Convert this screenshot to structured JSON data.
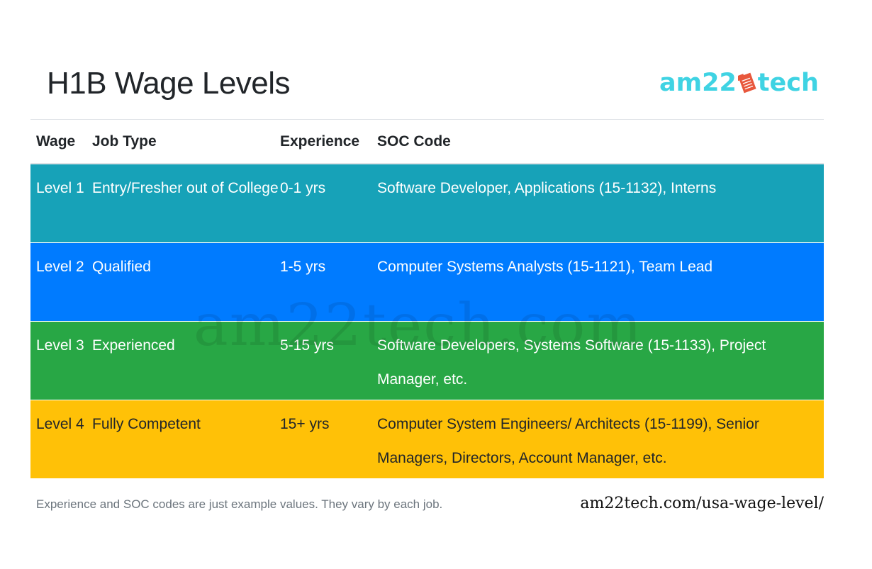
{
  "title": "H1B Wage Levels",
  "logo": {
    "text_left": "am22",
    "icon": "document-icon",
    "text_right": "tech",
    "brand_color": "#3fd3e3",
    "icon_color": "#e8573c"
  },
  "table": {
    "headers": [
      "Wage",
      "Job Type",
      "Experience",
      "SOC Code"
    ],
    "rows": [
      {
        "wage": "Level 1",
        "job_type": "Entry/Fresher out of College",
        "experience": "0-1 yrs",
        "soc_code": "Software Developer, Applications (15-1132), Interns",
        "color": "#17a2b8"
      },
      {
        "wage": "Level 2",
        "job_type": "Qualified",
        "experience": "1-5 yrs",
        "soc_code": "Computer Systems Analysts (15-1121), Team Lead",
        "color": "#007bff"
      },
      {
        "wage": "Level 3",
        "job_type": "Experienced",
        "experience": "5-15 yrs",
        "soc_code": "Software Developers, Systems Software (15-1133), Project Manager, etc.",
        "color": "#28a745"
      },
      {
        "wage": "Level 4",
        "job_type": "Fully Competent",
        "experience": "15+ yrs",
        "soc_code": "Computer System Engineers/ Architects (15-1199), Senior Managers, Directors, Account Manager, etc.",
        "color": "#ffc107"
      }
    ]
  },
  "watermark": "am22tech.com",
  "footnote": "Experience and SOC codes are just example values. They vary by each job.",
  "source_url": "am22tech.com/usa-wage-level/"
}
